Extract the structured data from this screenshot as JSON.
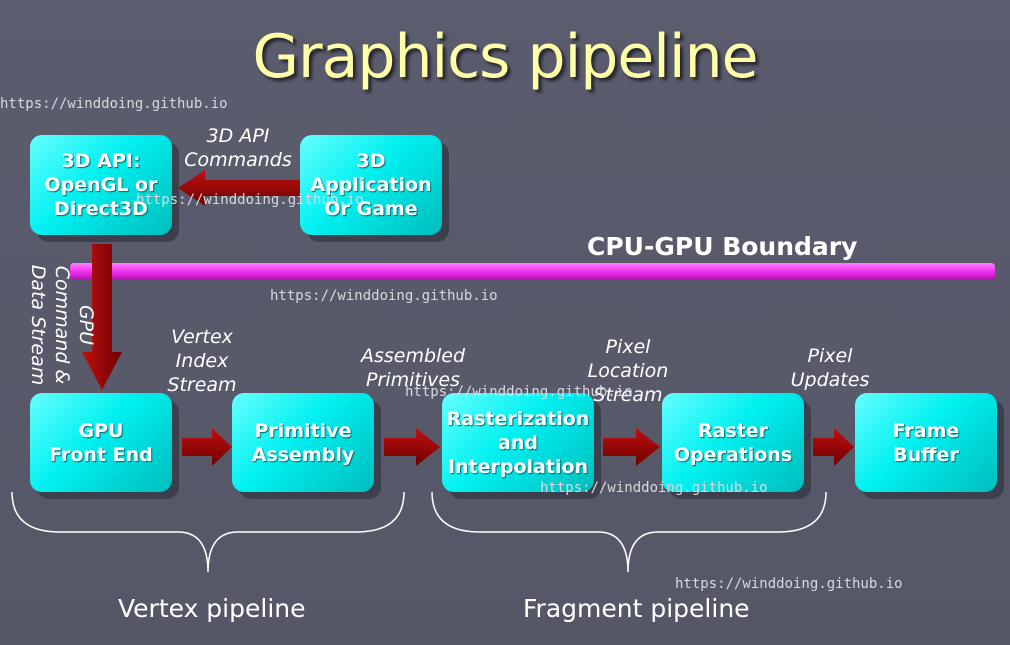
{
  "title": "Graphics pipeline",
  "boundary_label": "CPU-GPU Boundary",
  "boxes": {
    "api": "3D API:\nOpenGL or\nDirect3D",
    "application": "3D\nApplication\nOr Game",
    "front_end": "GPU\nFront End",
    "primitive_assembly": "Primitive\nAssembly",
    "rasterization": "Rasterization\nand\nInterpolation",
    "raster_ops": "Raster\nOperations",
    "frame_buffer": "Frame\nBuffer"
  },
  "labels": {
    "api_commands": "3D API\nCommands",
    "gpu_stream": "GPU\nCommand &\nData Stream",
    "vertex_index": "Vertex\nIndex\nStream",
    "assembled": "Assembled\nPrimitives",
    "pixel_location": "Pixel\nLocation\nStream",
    "pixel_updates": "Pixel\nUpdates"
  },
  "groups": {
    "vertex": "Vertex pipeline",
    "fragment": "Fragment pipeline"
  },
  "watermark": "https://winddoing.github.io",
  "colors": {
    "background": "#5b5d6e",
    "box": "#00f0f0",
    "arrow": "#990000",
    "boundary": "#ee33ee",
    "title": "#ffffa8"
  }
}
